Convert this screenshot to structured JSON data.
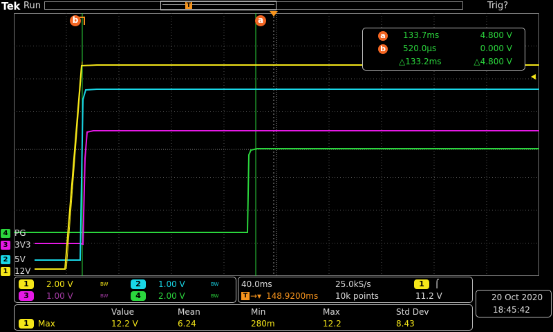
{
  "header": {
    "logo": "Tek",
    "run_state": "Run",
    "trigger_state": "Trig?",
    "record_trigger_glyph": "T"
  },
  "colors": {
    "ch1": "#f5e619",
    "ch2": "#19d6e6",
    "ch3": "#e619e6",
    "ch4": "#2bd63d",
    "cursor": "#f26522",
    "trigger": "#f7941d"
  },
  "cursors": {
    "a_label": "a",
    "b_label": "b",
    "a_time": "133.7ms",
    "a_volt": "4.800 V",
    "b_time": "520.0µs",
    "b_volt": "0.000 V",
    "delta_time": "△133.2ms",
    "delta_volt": "△4.800 V"
  },
  "channels": [
    {
      "num": "4",
      "name": "PG",
      "icon": "ch4-ground-marker"
    },
    {
      "num": "3",
      "name": "3V3",
      "icon": "ch3-ground-marker"
    },
    {
      "num": "2",
      "name": "5V",
      "icon": "ch2-ground-marker"
    },
    {
      "num": "1",
      "name": "12V",
      "icon": "ch1-ground-marker"
    }
  ],
  "vertical": {
    "ch1": {
      "num": "1",
      "scale": "2.00 V",
      "bw": "BW"
    },
    "ch2": {
      "num": "2",
      "scale": "1.00 V",
      "bw": "BW"
    },
    "ch3": {
      "num": "3",
      "scale": "1.00 V",
      "bw": "BW"
    },
    "ch4": {
      "num": "4",
      "scale": "2.00 V",
      "bw": "BW"
    }
  },
  "horizontal": {
    "time_div": "40.0ms",
    "sample_rate": "25.0kS/s",
    "trigger_pos": "148.9200ms",
    "record_length": "10k points",
    "trigger_source": "1",
    "trigger_level": "11.2 V",
    "trigger_slope": "⌠"
  },
  "datetime": {
    "date": "20 Oct  2020",
    "time": "18:45:42"
  },
  "measurement": {
    "headers": [
      "Value",
      "Mean",
      "Min",
      "Max",
      "Std Dev"
    ],
    "source": "1",
    "name": "Max",
    "values": [
      "12.2 V",
      "6.24",
      "280m",
      "12.2",
      "8.43"
    ]
  }
}
